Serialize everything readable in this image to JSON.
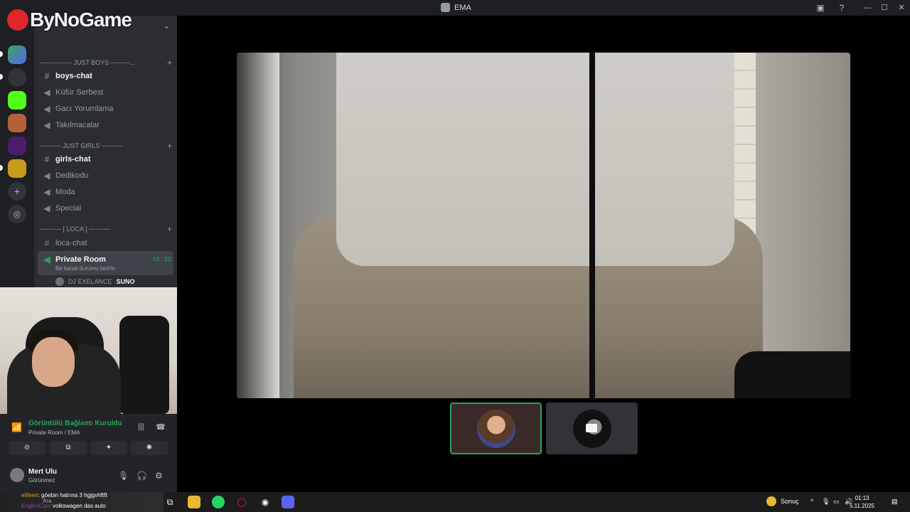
{
  "window": {
    "title": "EMA",
    "controls": [
      "—",
      "☐",
      "✕"
    ]
  },
  "overlay": {
    "logo_text": "ByNoGame"
  },
  "sidebar": {
    "categories": [
      {
        "label": "--------------- JUST BOYS ---------..."
      },
      {
        "label": "---------- JUST GIRLS ----------"
      },
      {
        "label": "---------- [ LOCA ] ----------"
      }
    ],
    "channels": [
      {
        "label": "boys-chat",
        "type": "text"
      },
      {
        "label": "Küfür Serbest",
        "type": "voice"
      },
      {
        "label": "Gacı Yorumlama",
        "type": "voice"
      },
      {
        "label": "Takılmacalar",
        "type": "voice"
      },
      {
        "label": "girls-chat",
        "type": "text"
      },
      {
        "label": "Dedikodu",
        "type": "voice"
      },
      {
        "label": "Moda",
        "type": "voice"
      },
      {
        "label": "Special",
        "type": "voice"
      },
      {
        "label": "loca-chat",
        "type": "text"
      },
      {
        "label": "Private Room",
        "type": "voice",
        "time": "16:32",
        "sub": "Bir kanal durumu belirle"
      }
    ],
    "voice_member": {
      "name": "DJ EXELANCE",
      "tag": "SUNO"
    }
  },
  "voice_panel": {
    "status": "Görüntülü Bağlantı Kuruldu",
    "location": "Private Room / EMA"
  },
  "user": {
    "name": "Mert Ulu",
    "status": "Görünmez"
  },
  "taskbar": {
    "ticker_line1_user": "elifeen",
    "ticker_line1_text": ": göebin hatrına 3 hgjgvhftft",
    "ticker_line2_user": "EnginnCan",
    "ticker_line2_text": ": volkswagen das auto",
    "search_label": "Ara",
    "weather_label": "Sonuç",
    "time": "01:13",
    "date": "5.11.2025"
  },
  "colors": {
    "accent_green": "#23a55a",
    "sidebar_bg": "#2b2d31",
    "rail_bg": "#1e1f22"
  }
}
